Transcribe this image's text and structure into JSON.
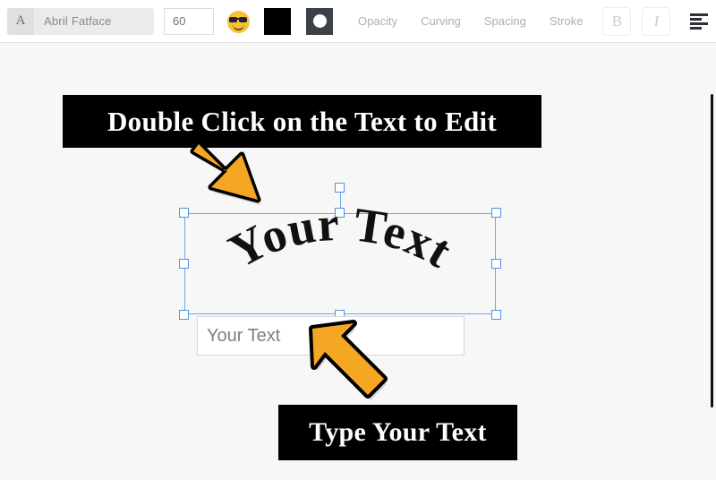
{
  "toolbar": {
    "font_icon": "letter-a-icon",
    "font_family_value": "Abril Fatface",
    "font_size_value": "60",
    "emoji_icon": "sunglasses-smiley-icon",
    "fill_color_swatch": "#000000",
    "outline_color_swatch": "#3b4147",
    "opacity_label": "Opacity",
    "curving_label": "Curving",
    "spacing_label": "Spacing",
    "stroke_label": "Stroke",
    "bold_label": "B",
    "italic_label": "I",
    "align_left_icon": "align-left-icon",
    "align_center_icon": "align-center-icon"
  },
  "canvas": {
    "banner_top_text": "Double Click on the Text to Edit",
    "banner_bottom_text": "Type Your Text",
    "artwork_text": "Your Text",
    "text_input_value": "Your Text",
    "arrow_top_icon": "bent-arrow-down-right-icon",
    "arrow_bottom_icon": "arrow-up-left-icon",
    "arrow_color": "#f5a623",
    "selection_color": "#4f92e0",
    "background_color": "#f7f7f7"
  }
}
